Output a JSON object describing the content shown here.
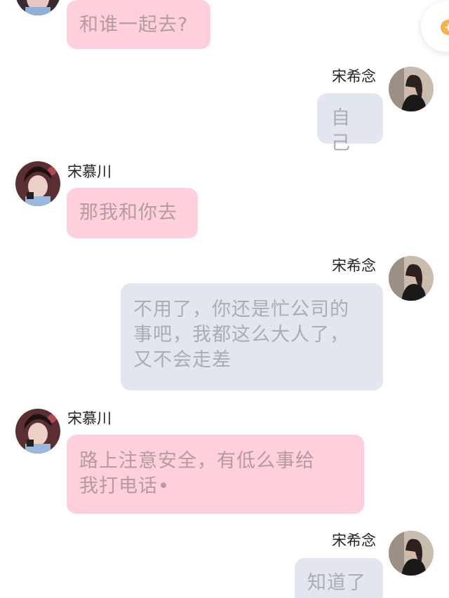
{
  "contacts": {
    "left_name": "宋慕川",
    "right_name": "宋希念"
  },
  "messages": [
    {
      "side": "left",
      "text": "和谁一起去?"
    },
    {
      "side": "right",
      "text": "自己"
    },
    {
      "side": "left",
      "text": "那我和你去"
    },
    {
      "side": "right",
      "lines": [
        "不用了，你还是忙公司的",
        "事吧，我都这么大人了，",
        "又不会走差"
      ]
    },
    {
      "side": "left",
      "lines": [
        "路上注意安全，有低么事给",
        "我打电话•"
      ]
    },
    {
      "side": "right",
      "text": "知道了"
    }
  ],
  "colors": {
    "left_bubble": "#ffd0dc",
    "right_bubble": "#e1e6ef",
    "accent": "#f6b24a"
  }
}
